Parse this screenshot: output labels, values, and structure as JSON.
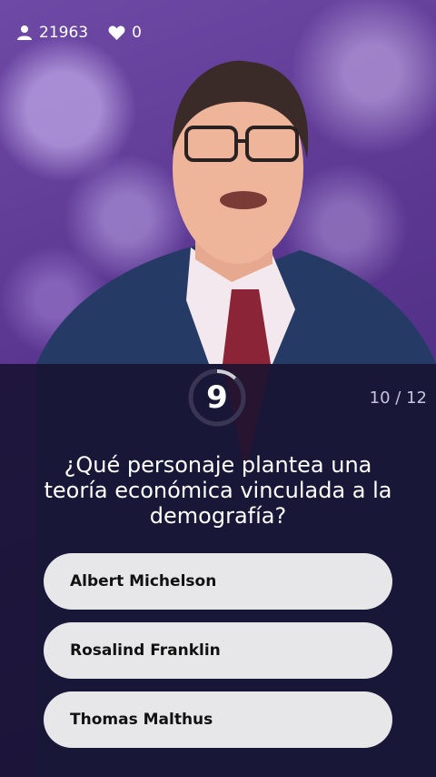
{
  "status": {
    "viewers": "21963",
    "likes": "0"
  },
  "timer": {
    "value": "9",
    "fraction_remaining": 0.12
  },
  "progress": "10 / 12",
  "question": "¿Qué personaje plantea una teoría económica vinculada a la demografía?",
  "answers": [
    {
      "label": "Albert Michelson"
    },
    {
      "label": "Rosalind Franklin"
    },
    {
      "label": "Thomas Malthus"
    }
  ],
  "colors": {
    "answer_bg": "#e7e7ea",
    "panel": "#16122f",
    "accent": "#ffffff"
  }
}
